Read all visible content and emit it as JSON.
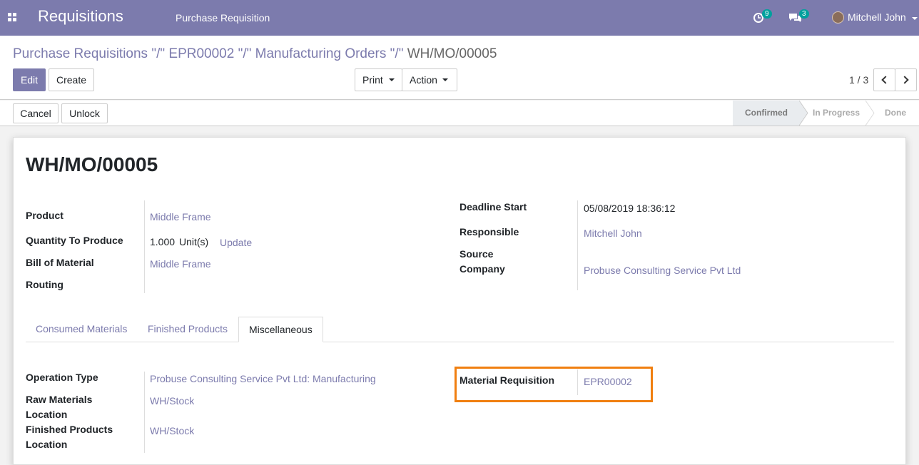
{
  "navbar": {
    "app_title": "Requisitions",
    "menu_item": "Purchase Requisition",
    "activity_count": "9",
    "message_count": "3",
    "user_name": "Mitchell John",
    "bg_color": "#7c7bad"
  },
  "breadcrumb": {
    "part1": "Purchase Requisitions",
    "sep1": "\"/\"",
    "part2": "EPR00002",
    "sep2": "\"/\"",
    "part3": "Manufacturing Orders",
    "sep3": "\"/\"",
    "current": "WH/MO/00005"
  },
  "buttons": {
    "edit": "Edit",
    "create": "Create",
    "print": "Print",
    "action": "Action",
    "cancel": "Cancel",
    "unlock": "Unlock"
  },
  "pager": {
    "value": "1 / 3"
  },
  "stages": {
    "confirmed": "Confirmed",
    "in_progress": "In Progress",
    "done": "Done"
  },
  "record": {
    "name": "WH/MO/00005",
    "product_label": "Product",
    "product": "Middle Frame",
    "qty_label": "Quantity To Produce",
    "qty": "1.000",
    "uom": "Unit(s)",
    "update": "Update",
    "bom_label": "Bill of Material",
    "bom": "Middle Frame",
    "routing_label": "Routing",
    "deadline_label": "Deadline Start",
    "deadline": "05/08/2019 18:36:12",
    "responsible_label": "Responsible",
    "responsible": "Mitchell John",
    "source_label": "Source",
    "company_label": "Company",
    "company": "Probuse Consulting Service Pvt Ltd"
  },
  "tabs": {
    "consumed": "Consumed Materials",
    "finished": "Finished Products",
    "misc": "Miscellaneous"
  },
  "misc": {
    "op_type_label": "Operation Type",
    "op_type": "Probuse Consulting Service Pvt Ltd: Manufacturing",
    "raw_loc_label1": "Raw Materials",
    "raw_loc_label2": "Location",
    "raw_loc": "WH/Stock",
    "fin_loc_label1": "Finished Products",
    "fin_loc_label2": "Location",
    "fin_loc": "WH/Stock",
    "mat_req_label": "Material Requisition",
    "mat_req": "EPR00002",
    "highlight_color": "#f07f10"
  }
}
